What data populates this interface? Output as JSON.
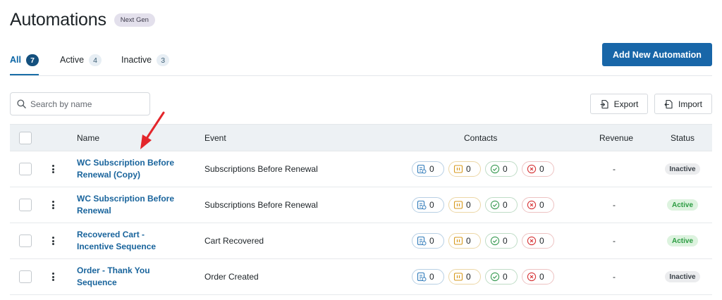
{
  "header": {
    "title": "Automations",
    "badge": "Next Gen"
  },
  "tabs": [
    {
      "label": "All",
      "count": "7"
    },
    {
      "label": "Active",
      "count": "4"
    },
    {
      "label": "Inactive",
      "count": "3"
    }
  ],
  "toolbar": {
    "add_label": "Add New Automation",
    "search_placeholder": "Search by name",
    "export_label": "Export",
    "import_label": "Import"
  },
  "table": {
    "columns": {
      "name": "Name",
      "event": "Event",
      "contacts": "Contacts",
      "revenue": "Revenue",
      "status": "Status"
    },
    "rows": [
      {
        "name_line1": "WC Subscription Before",
        "name_line2": "Renewal (Copy)",
        "event": "Subscriptions Before Renewal",
        "c1": "0",
        "c2": "0",
        "c3": "0",
        "c4": "0",
        "revenue": "-",
        "status": "Inactive"
      },
      {
        "name_line1": "WC Subscription Before",
        "name_line2": "Renewal",
        "event": "Subscriptions Before Renewal",
        "c1": "0",
        "c2": "0",
        "c3": "0",
        "c4": "0",
        "revenue": "-",
        "status": "Active"
      },
      {
        "name_line1": "Recovered Cart -",
        "name_line2": "Incentive Sequence",
        "event": "Cart Recovered",
        "c1": "0",
        "c2": "0",
        "c3": "0",
        "c4": "0",
        "revenue": "-",
        "status": "Active"
      },
      {
        "name_line1": "Order - Thank You",
        "name_line2": "Sequence",
        "event": "Order Created",
        "c1": "0",
        "c2": "0",
        "c3": "0",
        "c4": "0",
        "revenue": "-",
        "status": "Inactive"
      }
    ]
  },
  "icons": {
    "contact_pill_1": "contacts-queued-icon",
    "contact_pill_2": "paused-icon",
    "contact_pill_3": "completed-check-icon",
    "contact_pill_4": "failed-x-icon",
    "annotation": "red-arrow-icon"
  },
  "colors": {
    "primary": "#1866a8",
    "link": "#19649c",
    "active_text": "#2a9b40",
    "active_bg": "#ddf3df",
    "inactive_bg": "#ebecee",
    "arrow": "#e3262b"
  }
}
